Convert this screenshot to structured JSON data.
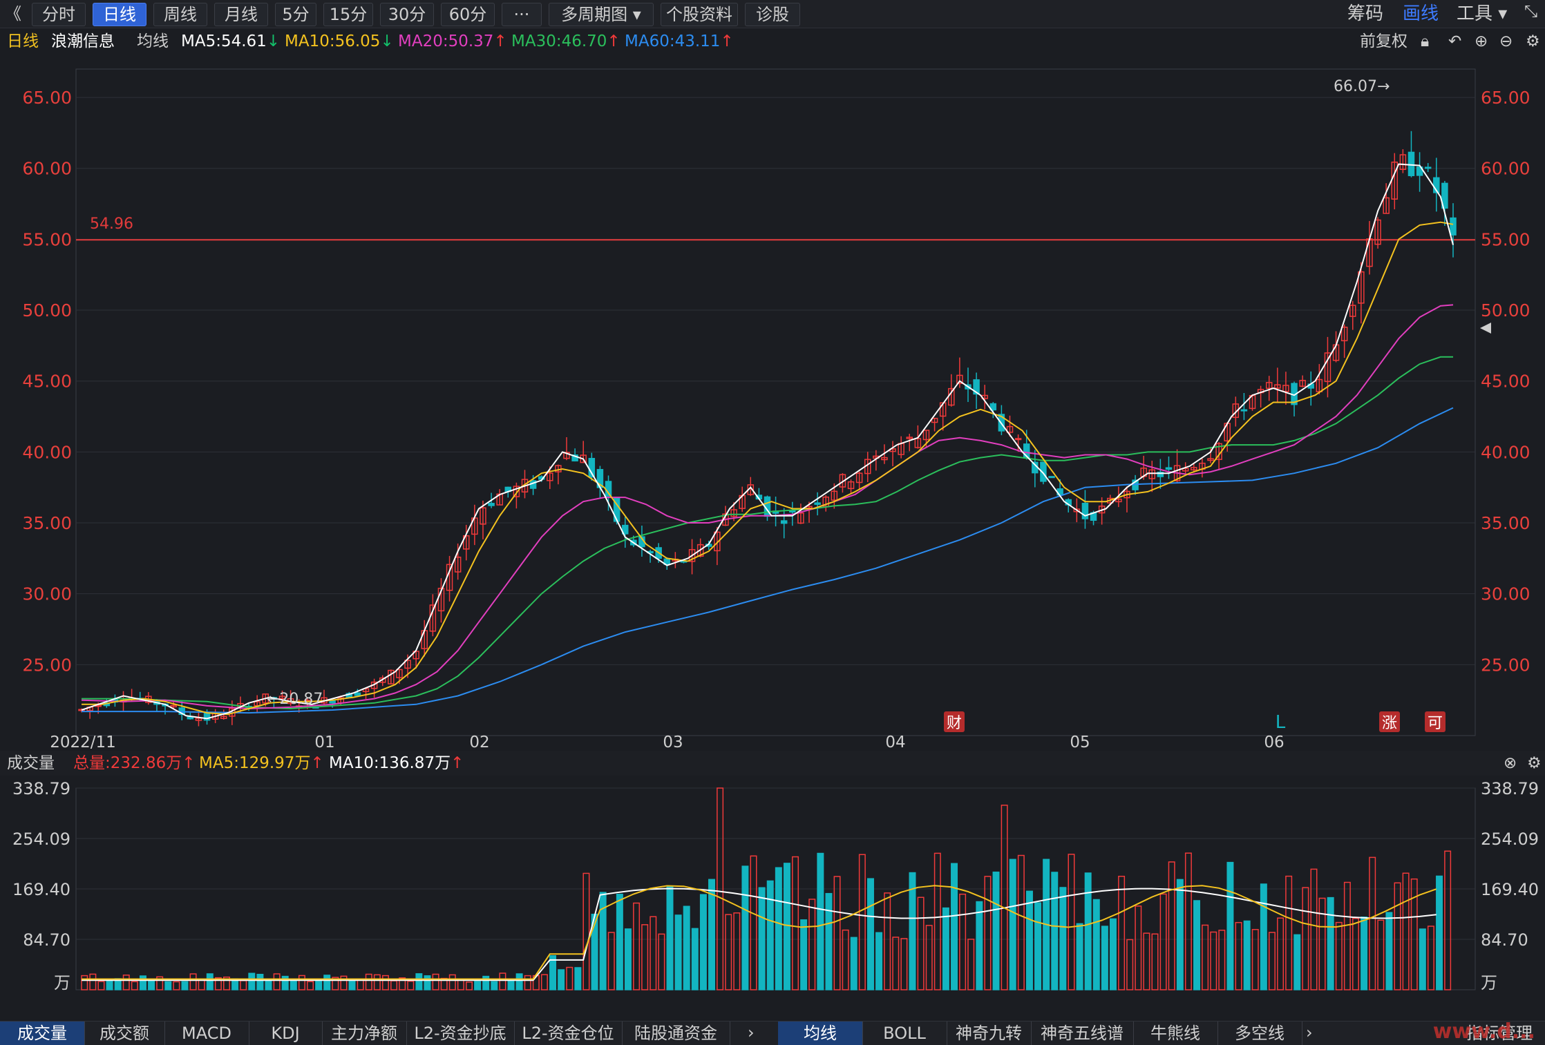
{
  "toolbar": {
    "back": "《",
    "tabs": [
      {
        "label": "分时",
        "active": false
      },
      {
        "label": "日线",
        "active": true
      },
      {
        "label": "周线",
        "active": false
      },
      {
        "label": "月线",
        "active": false
      },
      {
        "label": "5分",
        "active": false
      },
      {
        "label": "15分",
        "active": false
      },
      {
        "label": "30分",
        "active": false
      },
      {
        "label": "60分",
        "active": false
      },
      {
        "label": "···",
        "active": false
      },
      {
        "label": "多周期图 ▾",
        "active": false
      },
      {
        "label": "个股资料",
        "active": false
      },
      {
        "label": "诊股",
        "active": false
      }
    ],
    "right": {
      "chips": "筹码",
      "draw": "画线",
      "tools": "工具 ▾"
    }
  },
  "ma_header": {
    "period": "日线",
    "stock": "浪潮信息",
    "indicator": "均线",
    "ma5": "MA5:54.61",
    "ma10": "MA10:56.05",
    "ma20": "MA20:50.37",
    "ma30": "MA30:46.70",
    "ma60": "MA60:43.11",
    "adjust": "前复权"
  },
  "colors": {
    "up": "#f03a3a",
    "down": "#13b5c1",
    "ma5": "#ffffff",
    "ma10": "#f4c21f",
    "ma20": "#e23fbf",
    "ma30": "#2bbf5c",
    "ma60": "#2c8cf0",
    "axis_text": "#e8403c"
  },
  "chart_data": {
    "type": "candlestick",
    "y_axis_labels": [
      "65.00",
      "60.00",
      "55.00",
      "50.00",
      "45.00",
      "40.00",
      "35.00",
      "30.00",
      "25.00"
    ],
    "ylim": [
      20.0,
      67.0
    ],
    "x_labels": [
      "2022/11",
      "01",
      "02",
      "03",
      "04",
      "05",
      "06"
    ],
    "hline": {
      "value": 54.96,
      "label": "54.96"
    },
    "max_label": "66.07→",
    "min_label": "←20.87",
    "markers": [
      {
        "label": "财",
        "color": "#b52c2c"
      },
      {
        "label": "L",
        "color": "#13b5c1"
      },
      {
        "label": "涨",
        "color": "#b52c2c"
      },
      {
        "label": "可",
        "color": "#b52c2c"
      }
    ],
    "ma5_path": [
      [
        0,
        21.8
      ],
      [
        10,
        22.3
      ],
      [
        20,
        22.8
      ],
      [
        30,
        22.5
      ],
      [
        40,
        22.2
      ],
      [
        50,
        21.4
      ],
      [
        60,
        21.2
      ],
      [
        70,
        21.6
      ],
      [
        80,
        22.3
      ],
      [
        90,
        22.7
      ],
      [
        100,
        22.4
      ],
      [
        110,
        22.2
      ],
      [
        120,
        22.6
      ],
      [
        130,
        23.0
      ],
      [
        140,
        23.6
      ],
      [
        150,
        24.5
      ],
      [
        160,
        26.0
      ],
      [
        170,
        29.5
      ],
      [
        180,
        33.0
      ],
      [
        190,
        36.0
      ],
      [
        200,
        37.0
      ],
      [
        210,
        37.5
      ],
      [
        220,
        38.0
      ],
      [
        230,
        40.0
      ],
      [
        240,
        39.5
      ],
      [
        250,
        37.0
      ],
      [
        260,
        34.0
      ],
      [
        270,
        33.0
      ],
      [
        280,
        32.0
      ],
      [
        290,
        32.5
      ],
      [
        300,
        33.5
      ],
      [
        310,
        36.0
      ],
      [
        320,
        37.5
      ],
      [
        330,
        35.5
      ],
      [
        340,
        35.5
      ],
      [
        350,
        36.5
      ],
      [
        360,
        37.5
      ],
      [
        370,
        38.5
      ],
      [
        380,
        39.5
      ],
      [
        390,
        40.5
      ],
      [
        400,
        41.0
      ],
      [
        410,
        43.0
      ],
      [
        420,
        45.0
      ],
      [
        430,
        44.0
      ],
      [
        440,
        42.0
      ],
      [
        450,
        40.0
      ],
      [
        460,
        38.5
      ],
      [
        470,
        36.5
      ],
      [
        480,
        35.5
      ],
      [
        490,
        36.0
      ],
      [
        500,
        37.5
      ],
      [
        510,
        38.5
      ],
      [
        520,
        38.5
      ],
      [
        530,
        39.0
      ],
      [
        540,
        40.0
      ],
      [
        550,
        42.5
      ],
      [
        560,
        44.0
      ],
      [
        570,
        44.5
      ],
      [
        580,
        44.0
      ],
      [
        590,
        45.0
      ],
      [
        600,
        47.5
      ],
      [
        610,
        52.0
      ],
      [
        620,
        57.0
      ],
      [
        630,
        60.3
      ],
      [
        640,
        60.2
      ],
      [
        650,
        58.0
      ],
      [
        656,
        54.6
      ]
    ],
    "ma10_path": [
      [
        0,
        22.2
      ],
      [
        10,
        22.2
      ],
      [
        20,
        22.5
      ],
      [
        30,
        22.6
      ],
      [
        40,
        22.4
      ],
      [
        50,
        22.0
      ],
      [
        60,
        21.6
      ],
      [
        70,
        21.5
      ],
      [
        80,
        21.9
      ],
      [
        90,
        22.3
      ],
      [
        100,
        22.4
      ],
      [
        110,
        22.4
      ],
      [
        120,
        22.5
      ],
      [
        130,
        22.7
      ],
      [
        140,
        23.0
      ],
      [
        150,
        23.6
      ],
      [
        160,
        24.8
      ],
      [
        170,
        27.0
      ],
      [
        180,
        30.0
      ],
      [
        190,
        33.0
      ],
      [
        200,
        35.5
      ],
      [
        210,
        37.5
      ],
      [
        220,
        38.5
      ],
      [
        230,
        38.8
      ],
      [
        240,
        38.5
      ],
      [
        250,
        37.5
      ],
      [
        260,
        35.5
      ],
      [
        270,
        33.5
      ],
      [
        280,
        32.5
      ],
      [
        290,
        32.3
      ],
      [
        300,
        33.0
      ],
      [
        310,
        34.5
      ],
      [
        320,
        36.0
      ],
      [
        330,
        36.5
      ],
      [
        340,
        36.0
      ],
      [
        350,
        36.0
      ],
      [
        360,
        36.5
      ],
      [
        370,
        37.2
      ],
      [
        380,
        38.0
      ],
      [
        390,
        39.0
      ],
      [
        400,
        40.0
      ],
      [
        410,
        41.5
      ],
      [
        420,
        42.5
      ],
      [
        430,
        43.0
      ],
      [
        440,
        42.5
      ],
      [
        450,
        41.5
      ],
      [
        460,
        39.5
      ],
      [
        470,
        37.5
      ],
      [
        480,
        36.5
      ],
      [
        490,
        36.5
      ],
      [
        500,
        37.0
      ],
      [
        510,
        37.2
      ],
      [
        520,
        37.8
      ],
      [
        530,
        38.5
      ],
      [
        540,
        39.0
      ],
      [
        550,
        41.0
      ],
      [
        560,
        42.5
      ],
      [
        570,
        43.5
      ],
      [
        580,
        43.5
      ],
      [
        590,
        44.0
      ],
      [
        600,
        45.0
      ],
      [
        610,
        48.0
      ],
      [
        620,
        51.5
      ],
      [
        630,
        55.0
      ],
      [
        640,
        56.0
      ],
      [
        650,
        56.2
      ],
      [
        656,
        56.05
      ]
    ],
    "ma20_path": [
      [
        0,
        22.5
      ],
      [
        20,
        22.4
      ],
      [
        40,
        22.5
      ],
      [
        60,
        22.1
      ],
      [
        80,
        21.9
      ],
      [
        100,
        22.0
      ],
      [
        120,
        22.2
      ],
      [
        140,
        22.6
      ],
      [
        150,
        23.0
      ],
      [
        160,
        23.6
      ],
      [
        170,
        24.5
      ],
      [
        180,
        26.0
      ],
      [
        190,
        28.0
      ],
      [
        200,
        30.0
      ],
      [
        210,
        32.0
      ],
      [
        220,
        34.0
      ],
      [
        230,
        35.5
      ],
      [
        240,
        36.5
      ],
      [
        250,
        36.8
      ],
      [
        260,
        36.8
      ],
      [
        270,
        36.3
      ],
      [
        280,
        35.5
      ],
      [
        290,
        35.0
      ],
      [
        300,
        35.0
      ],
      [
        310,
        35.3
      ],
      [
        320,
        35.5
      ],
      [
        330,
        35.5
      ],
      [
        340,
        35.6
      ],
      [
        350,
        36.0
      ],
      [
        360,
        36.5
      ],
      [
        370,
        37.0
      ],
      [
        380,
        38.0
      ],
      [
        390,
        39.0
      ],
      [
        400,
        40.0
      ],
      [
        410,
        40.8
      ],
      [
        420,
        41.0
      ],
      [
        430,
        40.8
      ],
      [
        440,
        40.5
      ],
      [
        450,
        40.0
      ],
      [
        460,
        39.8
      ],
      [
        470,
        39.6
      ],
      [
        480,
        39.8
      ],
      [
        490,
        39.8
      ],
      [
        500,
        39.5
      ],
      [
        510,
        39.0
      ],
      [
        520,
        38.6
      ],
      [
        530,
        38.4
      ],
      [
        540,
        38.6
      ],
      [
        550,
        39.0
      ],
      [
        560,
        39.5
      ],
      [
        570,
        40.0
      ],
      [
        580,
        40.5
      ],
      [
        590,
        41.5
      ],
      [
        600,
        42.5
      ],
      [
        610,
        44.0
      ],
      [
        620,
        46.0
      ],
      [
        630,
        48.0
      ],
      [
        640,
        49.5
      ],
      [
        650,
        50.3
      ],
      [
        656,
        50.37
      ]
    ],
    "ma30_path": [
      [
        0,
        22.6
      ],
      [
        20,
        22.6
      ],
      [
        40,
        22.5
      ],
      [
        60,
        22.4
      ],
      [
        80,
        22.0
      ],
      [
        100,
        21.9
      ],
      [
        120,
        22.1
      ],
      [
        140,
        22.3
      ],
      [
        160,
        22.8
      ],
      [
        170,
        23.3
      ],
      [
        180,
        24.2
      ],
      [
        190,
        25.5
      ],
      [
        200,
        27.0
      ],
      [
        210,
        28.5
      ],
      [
        220,
        30.0
      ],
      [
        230,
        31.2
      ],
      [
        240,
        32.3
      ],
      [
        250,
        33.2
      ],
      [
        260,
        33.8
      ],
      [
        270,
        34.2
      ],
      [
        280,
        34.6
      ],
      [
        290,
        35.0
      ],
      [
        300,
        35.3
      ],
      [
        310,
        35.6
      ],
      [
        320,
        35.6
      ],
      [
        330,
        35.8
      ],
      [
        340,
        35.9
      ],
      [
        350,
        36.0
      ],
      [
        360,
        36.2
      ],
      [
        370,
        36.3
      ],
      [
        380,
        36.5
      ],
      [
        390,
        37.2
      ],
      [
        400,
        38.0
      ],
      [
        410,
        38.7
      ],
      [
        420,
        39.3
      ],
      [
        430,
        39.6
      ],
      [
        440,
        39.8
      ],
      [
        450,
        39.6
      ],
      [
        460,
        39.4
      ],
      [
        470,
        39.4
      ],
      [
        480,
        39.6
      ],
      [
        490,
        39.8
      ],
      [
        500,
        39.8
      ],
      [
        510,
        40.0
      ],
      [
        520,
        40.0
      ],
      [
        530,
        40.0
      ],
      [
        540,
        40.3
      ],
      [
        550,
        40.5
      ],
      [
        560,
        40.5
      ],
      [
        570,
        40.5
      ],
      [
        580,
        40.8
      ],
      [
        590,
        41.3
      ],
      [
        600,
        42.0
      ],
      [
        610,
        43.0
      ],
      [
        620,
        44.0
      ],
      [
        630,
        45.2
      ],
      [
        640,
        46.2
      ],
      [
        650,
        46.7
      ],
      [
        656,
        46.7
      ]
    ],
    "ma60_path": [
      [
        0,
        21.7
      ],
      [
        40,
        21.7
      ],
      [
        80,
        21.6
      ],
      [
        120,
        21.8
      ],
      [
        160,
        22.2
      ],
      [
        180,
        22.8
      ],
      [
        200,
        23.8
      ],
      [
        220,
        25.0
      ],
      [
        240,
        26.3
      ],
      [
        260,
        27.3
      ],
      [
        280,
        28.0
      ],
      [
        300,
        28.7
      ],
      [
        320,
        29.5
      ],
      [
        340,
        30.3
      ],
      [
        360,
        31.0
      ],
      [
        380,
        31.8
      ],
      [
        400,
        32.8
      ],
      [
        420,
        33.8
      ],
      [
        440,
        35.0
      ],
      [
        460,
        36.5
      ],
      [
        480,
        37.5
      ],
      [
        500,
        37.7
      ],
      [
        520,
        37.8
      ],
      [
        540,
        37.9
      ],
      [
        560,
        38.0
      ],
      [
        580,
        38.5
      ],
      [
        600,
        39.2
      ],
      [
        620,
        40.3
      ],
      [
        640,
        42.0
      ],
      [
        656,
        43.11
      ]
    ]
  },
  "volume": {
    "label": "成交量",
    "total": "总量:232.86万",
    "ma5": "MA5:129.97万",
    "ma10": "MA10:136.87万",
    "y_labels": [
      "338.79",
      "254.09",
      "169.40",
      "84.70",
      "万"
    ],
    "ylim": [
      0,
      338.79
    ]
  },
  "bottom_tabs_left": [
    {
      "label": "成交量",
      "active": true
    },
    {
      "label": "成交额",
      "active": false
    },
    {
      "label": "MACD",
      "active": false
    },
    {
      "label": "KDJ",
      "active": false
    },
    {
      "label": "主力净额",
      "active": false
    },
    {
      "label": "L2-资金抄底",
      "active": false
    },
    {
      "label": "L2-资金仓位",
      "active": false
    },
    {
      "label": "陆股通资金",
      "active": false
    }
  ],
  "bottom_tabs_right": [
    {
      "label": "均线",
      "active": true
    },
    {
      "label": "BOLL",
      "active": false
    },
    {
      "label": "神奇九转",
      "active": false
    },
    {
      "label": "神奇五线谱",
      "active": false
    },
    {
      "label": "牛熊线",
      "active": false
    },
    {
      "label": "多空线",
      "active": false
    }
  ],
  "bottom_more": "指标管理",
  "watermark": "www.d..."
}
